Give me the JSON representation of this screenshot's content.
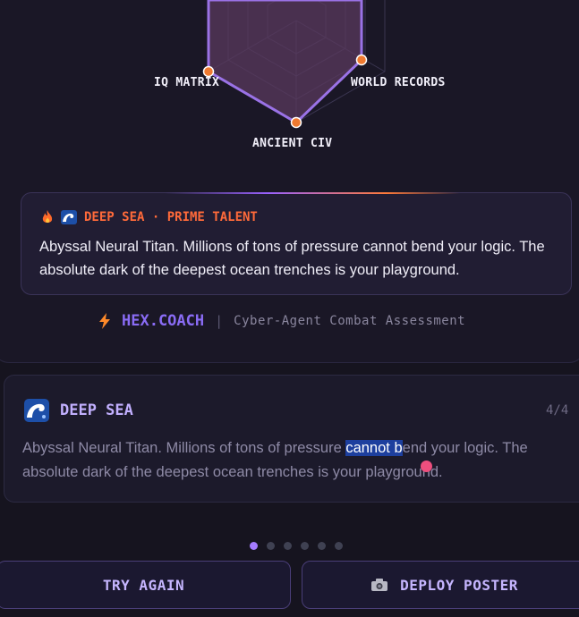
{
  "radar": {
    "axes": [
      "IQ MATRIX",
      "WORLD RECORDS",
      "ANCIENT CIV"
    ],
    "colors": {
      "fill": "#5a3a5e",
      "stroke": "#9a72e6",
      "point": "#f07a30"
    }
  },
  "talent": {
    "icons": [
      "fire-icon",
      "wave-icon"
    ],
    "heading": "DEEP SEA · PRIME TALENT",
    "text": "Abyssal Neural Titan. Millions of tons of pressure cannot bend your logic. The absolute dark of the deepest ocean trenches is your playground."
  },
  "brand": {
    "icon": "lightning-icon",
    "name": "HEX.COACH",
    "separator": "|",
    "tagline": "Cyber-Agent Combat Assessment"
  },
  "result": {
    "icon": "wave-icon",
    "title": "DEEP SEA",
    "count": "4/4",
    "text_before": "Abyssal Neural Titan. Millions of tons of pressure ",
    "text_selected": "cannot b",
    "text_after": "end your logic. The absolute dark of the deepest ocean trenches is your playground."
  },
  "pagination": {
    "total": 6,
    "active": 0
  },
  "buttons": {
    "try_again": "TRY AGAIN",
    "deploy_icon": "camera-icon",
    "deploy_poster": "DEPLOY POSTER"
  }
}
